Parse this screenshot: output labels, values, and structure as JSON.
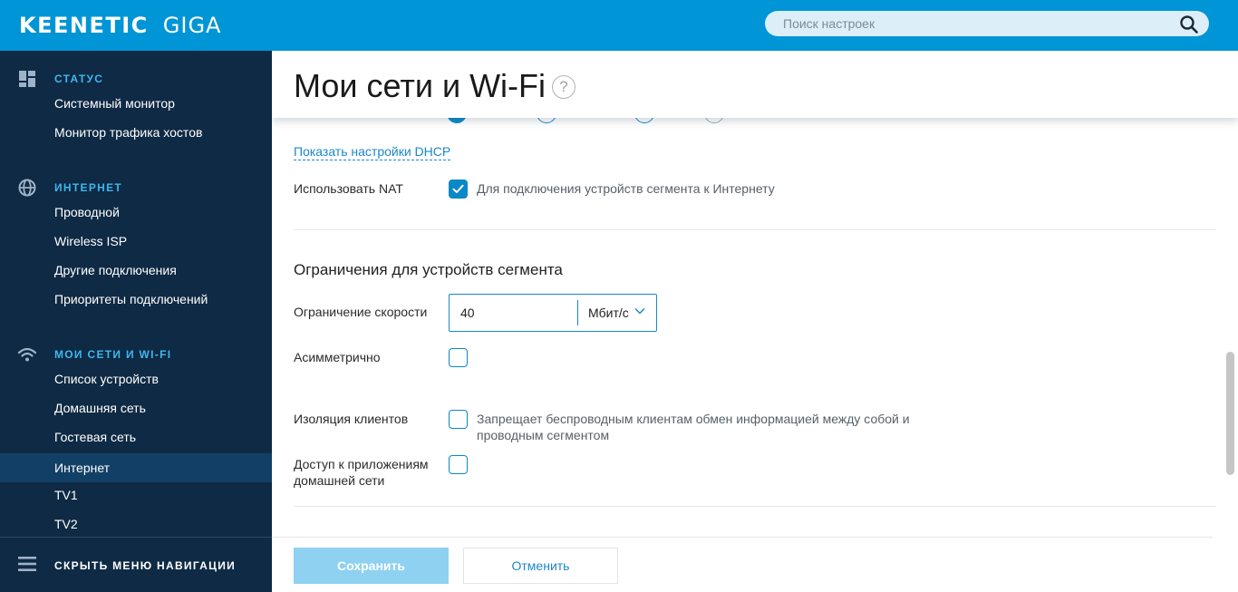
{
  "app": {
    "brand": "KEENETIC",
    "model": "GIGA"
  },
  "search": {
    "placeholder": "Поиск настроек"
  },
  "sidebar": {
    "sections": [
      {
        "title": "СТАТУС",
        "icon": "dashboard-icon",
        "items": [
          "Системный монитор",
          "Монитор трафика хостов"
        ]
      },
      {
        "title": "ИНТЕРНЕТ",
        "icon": "globe-icon",
        "items": [
          "Проводной",
          "Wireless ISP",
          "Другие подключения",
          "Приоритеты подключений"
        ]
      },
      {
        "title": "МОИ СЕТИ И WI-FI",
        "icon": "wifi-icon",
        "items": [
          "Список устройств",
          "Домашняя сеть",
          "Гостевая сеть",
          "Интернет",
          "TV1",
          "TV2"
        ]
      }
    ],
    "active_item": "Интернет",
    "footer_label": "СКРЫТЬ МЕНЮ НАВИГАЦИИ"
  },
  "page": {
    "title": "Мои сети и Wi-Fi",
    "help_glyph": "?"
  },
  "form": {
    "dhcp_link": "Показать настройки DHCP",
    "nat": {
      "label": "Использовать NAT",
      "checked": true,
      "description": "Для подключения устройств сегмента к Интернету"
    },
    "limits_heading": "Ограничения для устройств сегмента",
    "speed": {
      "label": "Ограничение скорости",
      "value": "40",
      "unit": "Мбит/с"
    },
    "asymmetric": {
      "label": "Асимметрично",
      "checked": false
    },
    "isolation": {
      "label": "Изоляция клиентов",
      "checked": false,
      "description_line1": "Запрещает беспроводным клиентам обмен информацией между собой и",
      "description_line2": "проводным сегментом"
    },
    "app_access": {
      "label_line1": "Доступ к приложениям",
      "label_line2": "домашней сети",
      "checked": false
    }
  },
  "actions": {
    "save": "Сохранить",
    "cancel": "Отменить"
  },
  "colors": {
    "topbar": "#0095d6",
    "sidebar": "#0f2a44",
    "sidebar_active": "#123f66",
    "section_title": "#3fb6ee",
    "accent": "#0a88c8",
    "save_disabled": "#8fd1f0"
  }
}
